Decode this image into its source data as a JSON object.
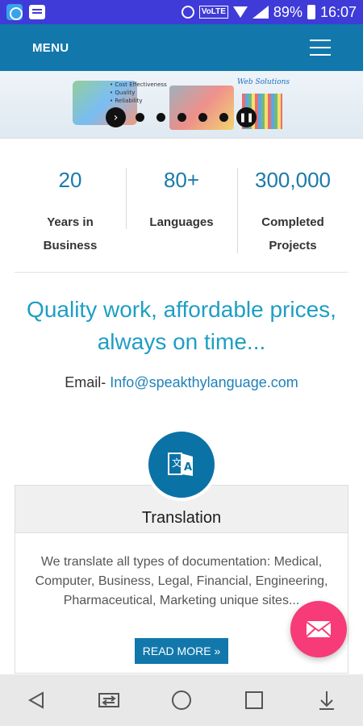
{
  "status_bar": {
    "volte": "VoLTE",
    "battery": "89%",
    "time": "16:07",
    "icons": [
      "app-sync-icon",
      "message-icon",
      "alarm-icon",
      "wifi-icon",
      "signal-icon",
      "battery-icon"
    ]
  },
  "header": {
    "menu_label": "MENU",
    "hamburger_icon": "hamburger-icon",
    "bg_color": "#1278ac"
  },
  "banner": {
    "text_small": "• Cost Effectiveness\n• Quality\n• Reliability",
    "text_right": "Web Solutions",
    "slides": 5,
    "controls": [
      "next-arrow-icon",
      "pause-icon"
    ]
  },
  "stats": [
    {
      "number": "20",
      "label": "Years in\nBusiness"
    },
    {
      "number": "80+",
      "label": "Languages"
    },
    {
      "number": "300,000",
      "label": "Completed\nProjects"
    }
  ],
  "tagline": "Quality work, affordable prices,\nalways on time...",
  "email": {
    "prefix": "Email- ",
    "address": "Info@speakthylanguage.com"
  },
  "service": {
    "title": "Translation",
    "description": "We translate all types of documentation: Medical, Computer, Business, Legal, Financial, Engineering, Pharmaceutical, Marketing unique sites...",
    "button": "READ MORE »",
    "icon": "translation-icon"
  },
  "fab": {
    "icon": "mail-icon",
    "color": "#f63b78"
  },
  "nav_bar": [
    "back-icon",
    "recent-swap-icon",
    "home-icon",
    "overview-icon",
    "notifications-down-icon"
  ]
}
